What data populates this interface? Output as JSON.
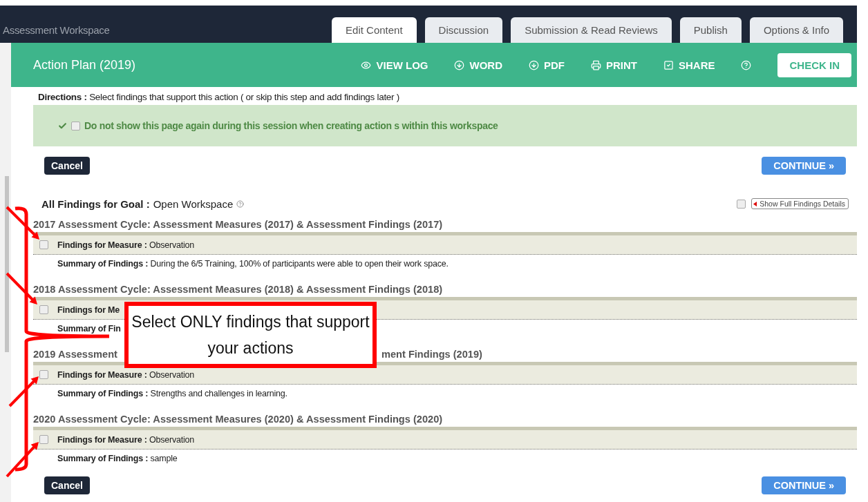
{
  "header": {
    "app_title": "Assessment Workspace"
  },
  "tabs": [
    {
      "label": "Edit Content",
      "selected": true
    },
    {
      "label": "Discussion",
      "selected": false
    },
    {
      "label": "Submission & Read Reviews",
      "selected": false
    },
    {
      "label": "Publish",
      "selected": false
    },
    {
      "label": "Options & Info",
      "selected": false
    }
  ],
  "toolbar": {
    "title": "Action Plan (2019)",
    "actions": [
      {
        "kind": "eye",
        "label": "VIEW LOG"
      },
      {
        "kind": "download",
        "label": "WORD"
      },
      {
        "kind": "download",
        "label": "PDF"
      },
      {
        "kind": "print",
        "label": "PRINT"
      },
      {
        "kind": "check",
        "label": "SHARE"
      },
      {
        "kind": "help"
      }
    ],
    "check_in": "CHECK IN"
  },
  "directions": {
    "label": "Directions :",
    "text": "Select findings that support this action ( or skip this step and add findings later )"
  },
  "notice": {
    "checked": false,
    "text": "Do not show this page again during this session when creating action s within this workspace"
  },
  "top_buttons": {
    "cancel": "Cancel",
    "continue": "CONTINUE »"
  },
  "goal": {
    "label": "All Findings for Goal :",
    "value": "Open Workspace"
  },
  "show_details": {
    "checked": false,
    "label": "Show Full Findings Details"
  },
  "cycles": [
    {
      "heading_parts": [
        "2017 Assessment Cycle: Assessment Measures (2017) & Assessment Findings (2017)"
      ],
      "checked": false,
      "measure_label": "Findings for Measure :",
      "measure_value": "Observation",
      "summary_label": "Summary of Findings :",
      "summary_value": "During the 6/5 Training, 100% of participants were able to open their work space."
    },
    {
      "heading_parts": [
        "2018 Assessment Cycle: Assessment Measures (2018) & Assessment Findings (2018)"
      ],
      "checked": false,
      "measure_label": "Findings for Me",
      "summary_label": "Summary of Fin"
    },
    {
      "heading_parts": [
        "2019 Assessment",
        "ment Findings (2019)"
      ],
      "checked": false,
      "measure_label": "Findings for Measure :",
      "measure_value": "Observation",
      "summary_label": "Summary of Findings :",
      "summary_value": "Strengths and challenges in learning."
    },
    {
      "heading_parts": [
        "2020 Assessment Cycle: Assessment Measures (2020) & Assessment Findings (2020)"
      ],
      "checked": false,
      "measure_label": "Findings for Measure :",
      "measure_value": "Observation",
      "summary_label": "Summary of Findings :",
      "summary_value": "sample"
    }
  ],
  "bottom_buttons": {
    "cancel": "Cancel",
    "continue": "CONTINUE »"
  },
  "callout": {
    "text": "Select ONLY findings that support your actions"
  }
}
